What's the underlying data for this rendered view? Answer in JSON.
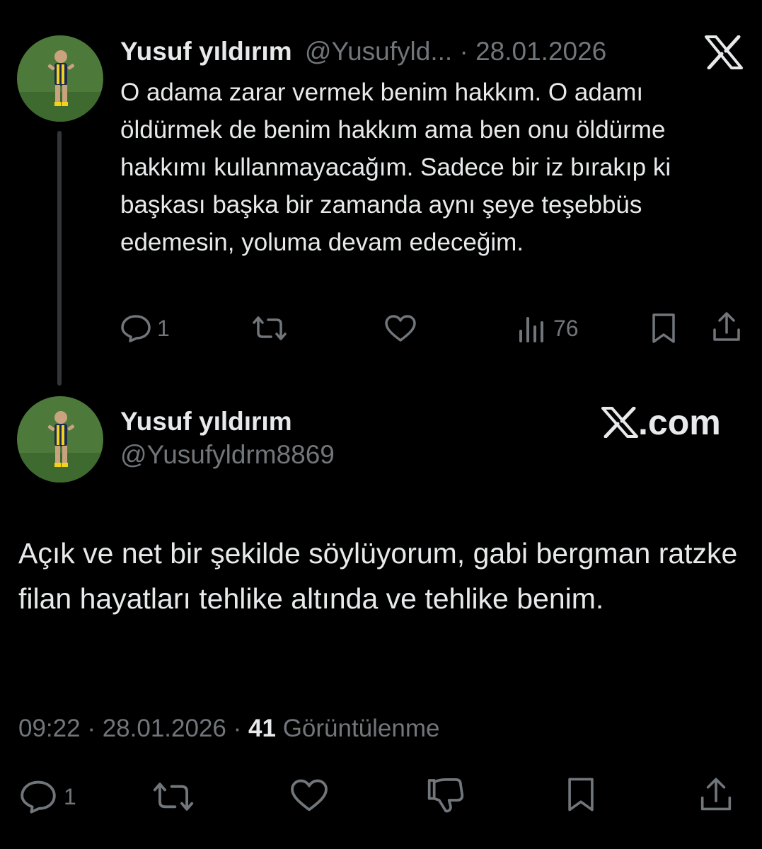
{
  "tweet1": {
    "author_name": "Yusuf yıldırım",
    "author_handle": "@Yusufyld...",
    "separator": "·",
    "date": "28.01.2026",
    "text": "O adama zarar vermek benim hakkım. O adamı öldürmek de benim hakkım ama ben onu öldürme hakkımı kullanmayacağım. Sadece  bir iz bırakıp ki başkası başka bir zamanda aynı şeye teşebbüs edemesin, yoluma devam edeceğim.",
    "replies": "1",
    "views": "76",
    "icons": [
      "reply-icon",
      "retweet-icon",
      "like-icon",
      "views-icon",
      "bookmark-icon",
      "share-icon"
    ]
  },
  "brand": {
    "x_logo": "x-logo-icon",
    "x_com_suffix": ".com"
  },
  "tweet2": {
    "author_name": "Yusuf yıldırım",
    "author_handle": "@Yusufyldrm8869",
    "text": "Açık ve net bir şekilde söylüyorum, gabi bergman ratzke filan hayatları tehlike altında ve tehlike benim.",
    "time": "09:22",
    "separator": "·",
    "date": "28.01.2026",
    "separator2": "·",
    "views_count": "41",
    "views_label": "Görüntülenme",
    "replies": "1",
    "icons": [
      "reply-icon",
      "retweet-icon",
      "like-icon",
      "dislike-icon",
      "bookmark-icon",
      "share-icon"
    ]
  },
  "colors": {
    "background": "#000000",
    "text": "#e7e9ea",
    "muted": "#71767b",
    "thread_line": "#333639"
  }
}
